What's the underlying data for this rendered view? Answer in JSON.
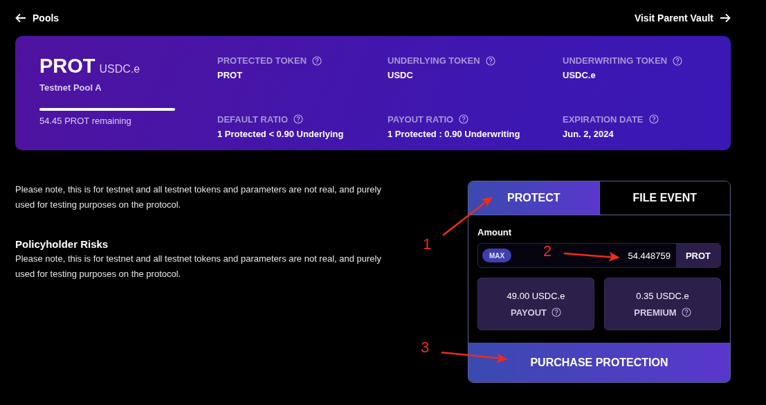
{
  "nav": {
    "back": "Pools",
    "forward": "Visit Parent Vault"
  },
  "pool": {
    "symbol": "PROT",
    "token": "USDC.e",
    "name": "Testnet Pool A",
    "level": 1,
    "remaining": "54.45 PROT remaining"
  },
  "details": [
    {
      "label": "PROTECTED TOKEN",
      "value": "PROT"
    },
    {
      "label": "UNDERLYING TOKEN",
      "value": "USDC"
    },
    {
      "label": "UNDERWRITING TOKEN",
      "value": "USDC.e"
    },
    {
      "label": "DEFAULT RATIO",
      "value": "1 Protected < 0.90 Underlying"
    },
    {
      "label": "PAYOUT RATIO",
      "value": "1 Protected : 0.90 Underwriting"
    },
    {
      "label": "EXPIRATION DATE",
      "value": "Jun. 2, 2024"
    }
  ],
  "note": "Please note, this is for testnet and all testnet tokens and parameters are not real, and purely used for testing purposes on the protocol.",
  "risks": {
    "title": "Policyholder Risks",
    "text": "Please note, this is for testnet and all testnet tokens and parameters are not real, and purely used for testing purposes on the protocol."
  },
  "tabs": [
    {
      "label": "PROTECT",
      "selected": true
    },
    {
      "label": "FILE EVENT",
      "selected": false
    }
  ],
  "amount": {
    "label": "Amount",
    "max": "MAX",
    "value": "54.448759",
    "unit": "PROT"
  },
  "stats": [
    {
      "value": "49.00 USDC.e",
      "label": "PAYOUT"
    },
    {
      "value": "0.35 USDC.e",
      "label": "PREMIUM"
    }
  ],
  "action": "PURCHASE PROTECTION",
  "annotations": [
    {
      "label": "1"
    },
    {
      "label": "2"
    },
    {
      "label": "3"
    }
  ]
}
